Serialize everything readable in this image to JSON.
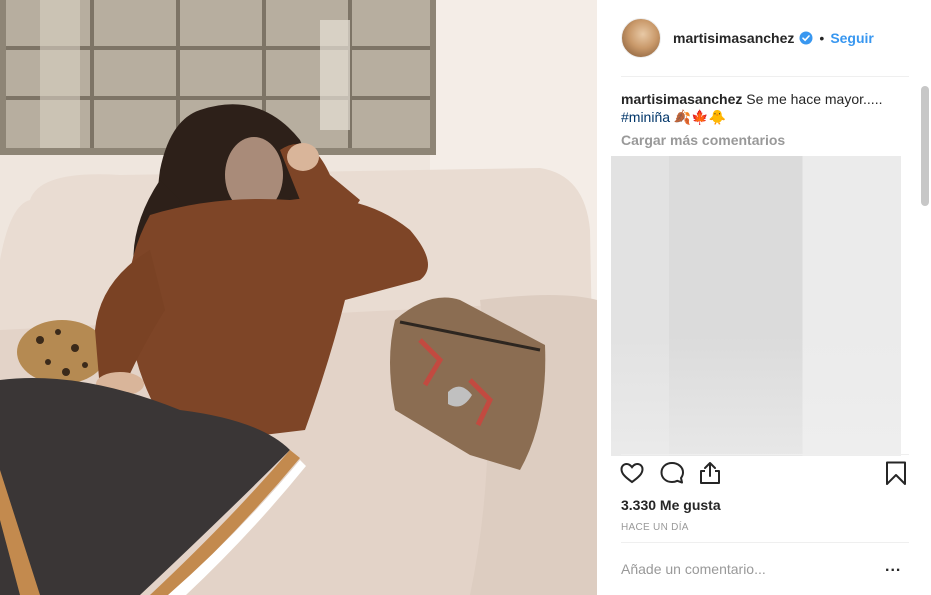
{
  "post": {
    "username": "martisimasanchez",
    "verified": true,
    "separator": "•",
    "follow_label": "Seguir",
    "caption_user": "martisimasanchez",
    "caption_text": " Se me hace mayor.....",
    "caption_hashtag": "#miniña",
    "caption_emoji": "🍂🍁🐥",
    "load_more_label": "Cargar más comentarios",
    "likes_label": "3.330 Me gusta",
    "time_label": "HACE UN DÍA",
    "comment_placeholder": "Añade un comentario...",
    "more_label": "..."
  },
  "icons": {
    "like": "heart-icon",
    "comment": "comment-icon",
    "share": "share-icon",
    "save": "bookmark-icon",
    "verified": "verified-badge-icon"
  },
  "colors": {
    "accent": "#3897f0",
    "text": "#262626",
    "muted": "#999999"
  }
}
